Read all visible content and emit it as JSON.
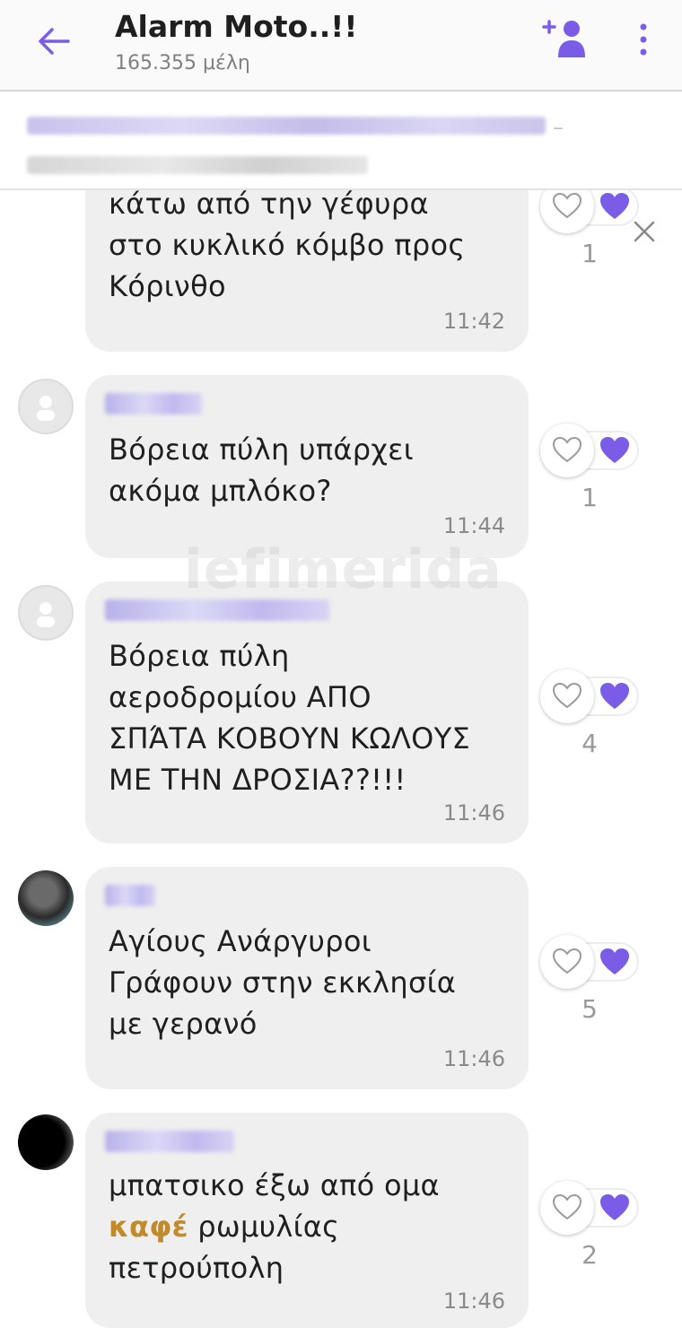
{
  "header": {
    "title": "Alarm Moto..!!",
    "subtitle": "165.355 μέλη"
  },
  "pinned": {
    "dash": "–"
  },
  "watermark": "iefimerida",
  "messages": [
    {
      "text": "κάτω από την γέφυρα\nστο κυκλικό κόμβο προς\nΚόρινθο",
      "time": "11:42",
      "likes": "1"
    },
    {
      "text": "Βόρεια πύλη υπάρχει\nακόμα μπλόκο?",
      "time": "11:44",
      "likes": "1"
    },
    {
      "text": "Βόρεια πύλη\nαεροδρομίου ΑΠΟ\nΣΠΆΤΑ ΚΟΒΟΥΝ ΚΩΛΟΥΣ\nΜΕ ΤΗΝ ΔΡΟΣΙΑ??!!!",
      "time": "11:46",
      "likes": "4"
    },
    {
      "text": "Αγίους Ανάργυροι\nΓράφουν στην εκκλησία\nμε γερανό",
      "time": "11:46",
      "likes": "5"
    },
    {
      "text_before": "μπατσικο έξω από ομα\n",
      "highlight": "καφέ",
      "text_after": " ρωμυλίας\nπετρούπολη",
      "time": "11:46",
      "likes": "2"
    }
  ],
  "colors": {
    "accent": "#7b5ce6",
    "bubble": "#efefef",
    "highlight": "#c18a2a"
  }
}
